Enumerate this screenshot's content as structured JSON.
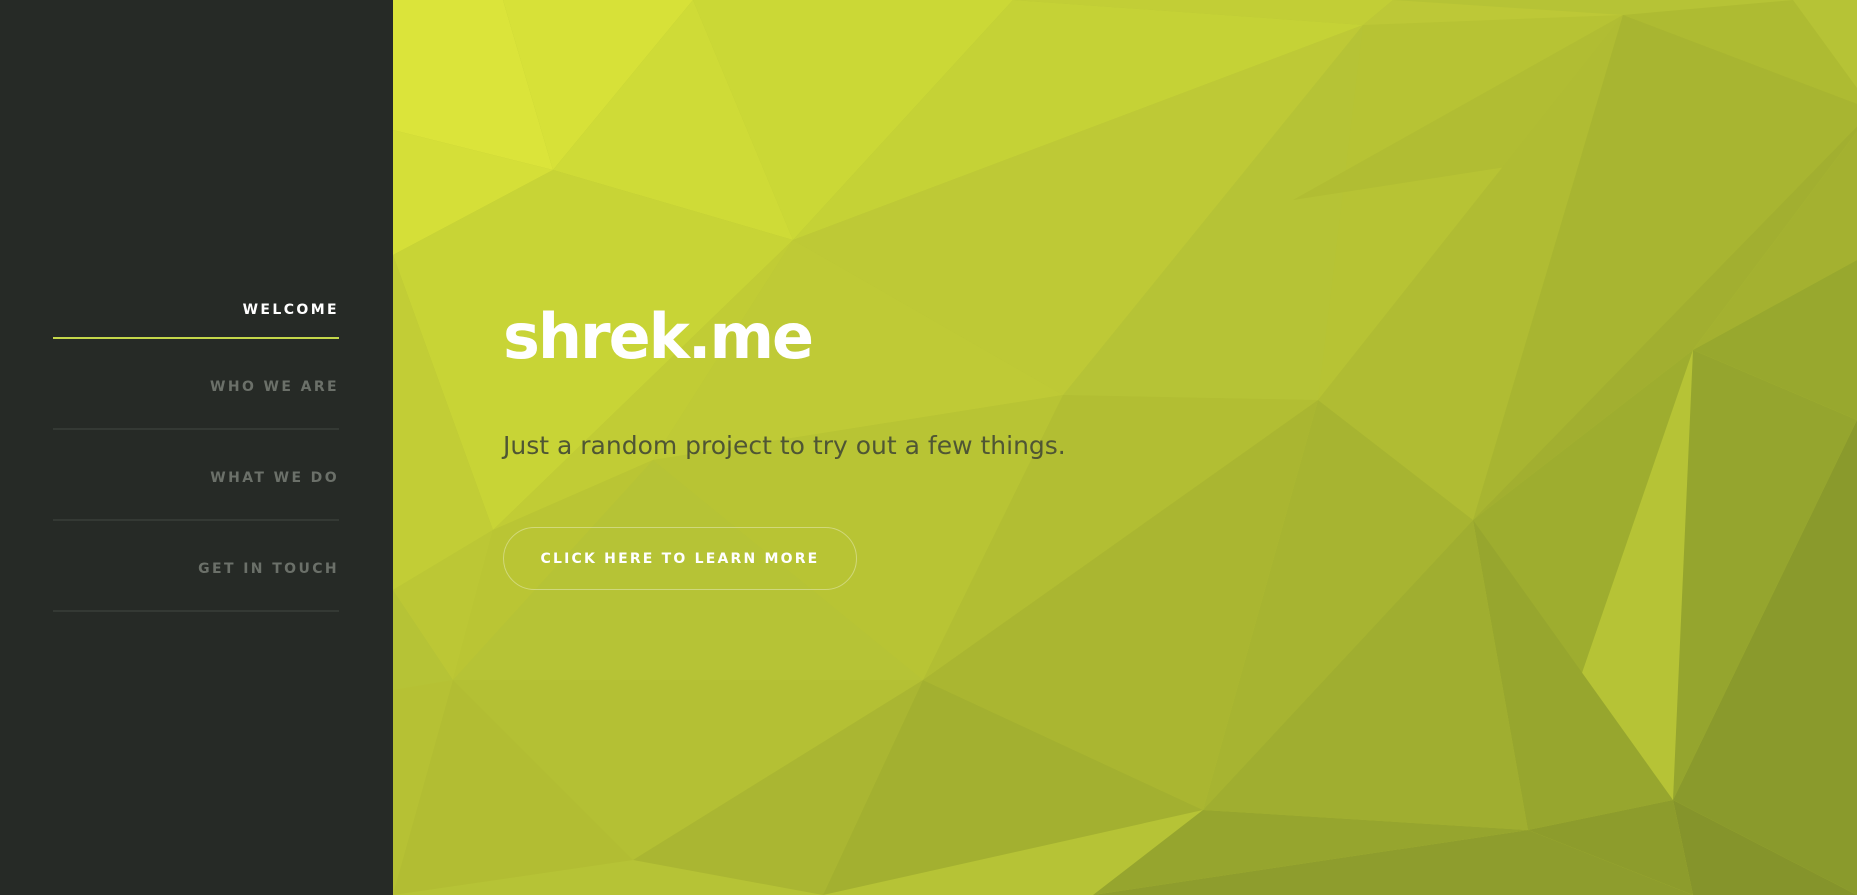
{
  "sidebar": {
    "items": [
      {
        "label": "WELCOME",
        "active": true
      },
      {
        "label": "WHO WE ARE",
        "active": false
      },
      {
        "label": "WHAT WE DO",
        "active": false
      },
      {
        "label": "GET IN TOUCH",
        "active": false
      }
    ]
  },
  "hero": {
    "title": "shrek.me",
    "subtitle": "Just a random project to try out a few things.",
    "cta_label": "CLICK HERE TO LEARN MORE"
  },
  "colors": {
    "sidebar_bg": "#262a26",
    "accent": "#c4d74a",
    "background_light": "#dde73c",
    "background_dark": "#7f922e",
    "nav_inactive": "#6b7069",
    "nav_active": "#ffffff"
  }
}
